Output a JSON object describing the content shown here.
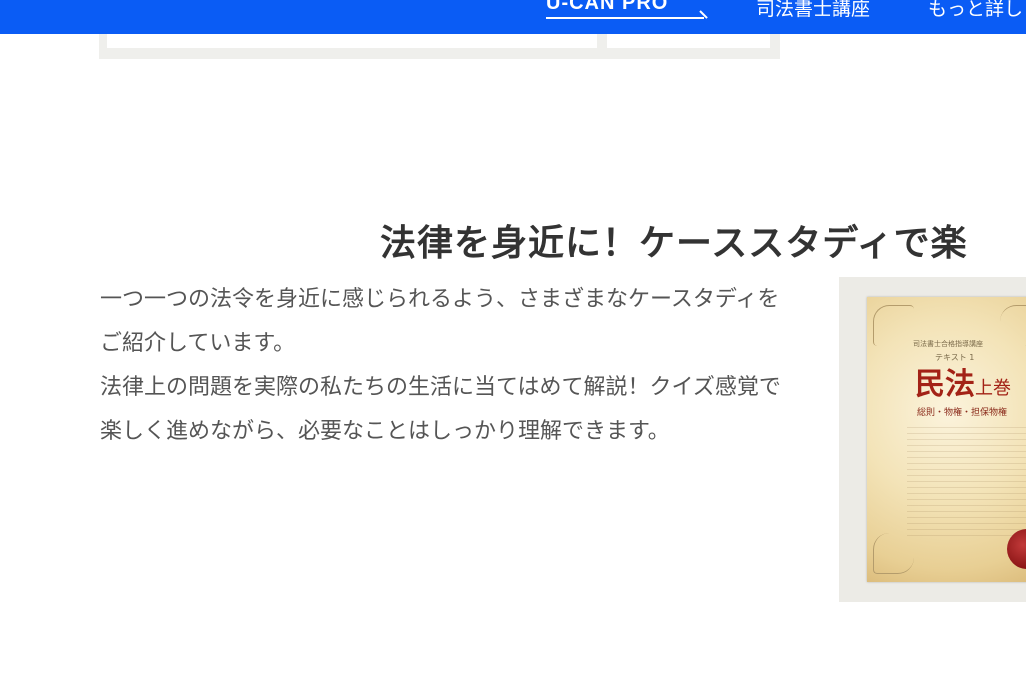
{
  "header": {
    "logo_text": "U-CAN PRO",
    "nav": [
      {
        "label": "司法書士講座"
      },
      {
        "label": "もっと詳し"
      }
    ]
  },
  "section": {
    "title": "法律を身近に！ケーススタディで楽",
    "paragraphs": [
      "一つ一つの法令を身近に感じられるよう、さまざまなケースタディをご紹介しています。",
      "法律上の問題を実際の私たちの生活に当てはめて解説！クイズ感覚で楽しく進めながら、必要なことはしっかり理解できます。"
    ]
  },
  "book": {
    "series": "司法書士合格指導講座",
    "label": "テキスト 1",
    "title": "民法",
    "title_suffix": "上巻",
    "subtitle": "総則・物権・担保物権"
  },
  "colors": {
    "header_bg": "#0a5cf5",
    "title_color": "#333333",
    "body_color": "#555555",
    "book_title_color": "#a32216"
  }
}
